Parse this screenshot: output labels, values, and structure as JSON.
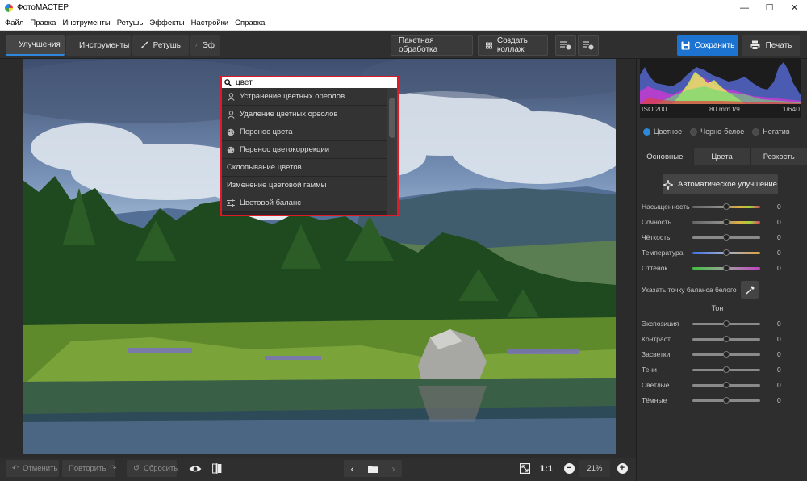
{
  "window": {
    "title": "ФотоМАСТЕР",
    "minimize_icon": "minimize-icon",
    "maximize_icon": "maximize-icon",
    "close_icon": "close-icon"
  },
  "menu": [
    "Файл",
    "Правка",
    "Инструменты",
    "Ретушь",
    "Эффекты",
    "Настройки",
    "Справка"
  ],
  "toolbar": {
    "tabs": [
      {
        "label": "Улучшения",
        "icon": "sliders-icon",
        "active": true
      },
      {
        "label": "Инструменты",
        "icon": "crop-icon",
        "active": false
      },
      {
        "label": "Ретушь",
        "icon": "brush-icon",
        "active": false
      },
      {
        "label": "Эф",
        "icon": "magic-icon",
        "active": false
      }
    ],
    "batch_label": "Пакетная обработка",
    "collage_label": "Создать коллаж",
    "save_label": "Сохранить",
    "print_label": "Печать"
  },
  "search": {
    "value": "цвет",
    "results": [
      {
        "label": "Устранение цветных ореолов",
        "icon": "person-icon"
      },
      {
        "label": "Удаление цветных ореолов",
        "icon": "person-icon"
      },
      {
        "label": "Перенос цвета",
        "icon": "palette-icon"
      },
      {
        "label": "Перенос цветокоррекции",
        "icon": "palette-icon"
      },
      {
        "label": "Склопывание цветов",
        "icon": ""
      },
      {
        "label": "Изменение цветовой гаммы",
        "icon": ""
      },
      {
        "label": "Цветовой баланс",
        "icon": "sliders-icon"
      }
    ]
  },
  "bottom": {
    "undo_label": "Отменить",
    "redo_label": "Повторить",
    "reset_label": "Сбросить",
    "ratio_label": "1:1",
    "zoom": "21%"
  },
  "panel": {
    "histogram": {
      "iso": "ISO 200",
      "lens": "80 mm f/9",
      "shutter": "1/640"
    },
    "color_modes": [
      {
        "label": "Цветное",
        "selected": true
      },
      {
        "label": "Черно-белое",
        "selected": false
      },
      {
        "label": "Негатив",
        "selected": false
      }
    ],
    "tabs": [
      {
        "label": "Основные",
        "active": true
      },
      {
        "label": "Цвета",
        "active": false
      },
      {
        "label": "Резкость",
        "active": false
      }
    ],
    "auto_label": "Автоматическое улучшение",
    "color_sliders": [
      {
        "label": "Насыщенность",
        "value": "0"
      },
      {
        "label": "Сочность",
        "value": "0"
      },
      {
        "label": "Чёткость",
        "value": "0"
      },
      {
        "label": "Температура",
        "value": "0"
      },
      {
        "label": "Оттенок",
        "value": "0"
      }
    ],
    "wb_label": "Указать точку баланса белого",
    "tone_title": "Тон",
    "tone_sliders": [
      {
        "label": "Экспозиция",
        "value": "0"
      },
      {
        "label": "Контраст",
        "value": "0"
      },
      {
        "label": "Засветки",
        "value": "0"
      },
      {
        "label": "Тени",
        "value": "0"
      },
      {
        "label": "Светлые",
        "value": "0"
      },
      {
        "label": "Тёмные",
        "value": "0"
      }
    ]
  },
  "colors": {
    "accent": "#1d74d0",
    "highlight": "#e0192a"
  }
}
